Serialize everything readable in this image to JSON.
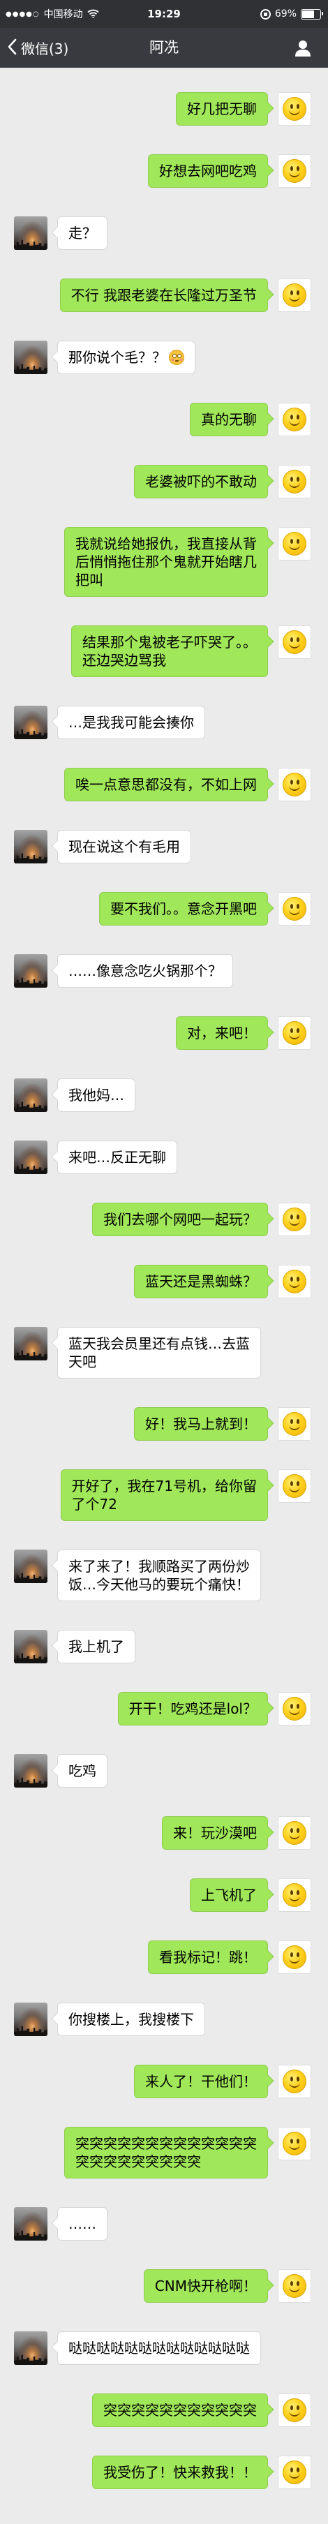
{
  "status_bar": {
    "signal": "●●●●○",
    "carrier": "中国移动",
    "time": "19:29",
    "battery_percent": "69%",
    "icons": [
      "wifi-icon",
      "rotation-lock-icon",
      "battery-icon"
    ]
  },
  "nav_bar": {
    "back_label": "微信(3)",
    "title": "阿冼",
    "icons": [
      "chevron-left-icon",
      "person-icon"
    ]
  },
  "colors": {
    "chat_background": "#ebebeb",
    "sent_bubble": "#a0e759",
    "received_bubble": "#ffffff",
    "nav_bar": "#393a3f"
  },
  "messages": [
    {
      "side": "right",
      "lines": [
        "好几把无聊"
      ]
    },
    {
      "side": "right",
      "lines": [
        "好想去网吧吃鸡"
      ]
    },
    {
      "side": "left",
      "lines": [
        "走？"
      ]
    },
    {
      "side": "right",
      "lines": [
        "不行 我跟老婆在长隆过万圣节"
      ]
    },
    {
      "side": "left",
      "lines": [
        "那你说个毛？？"
      ],
      "emoji": "flushed-face"
    },
    {
      "side": "right",
      "lines": [
        "真的无聊"
      ]
    },
    {
      "side": "right",
      "lines": [
        "老婆被吓的不敢动"
      ]
    },
    {
      "side": "right",
      "lines": [
        "我就说给她报仇，我直接从背",
        "后悄悄拖住那个鬼就开始瞎几",
        "把叫"
      ]
    },
    {
      "side": "right",
      "lines": [
        "结果那个鬼被老子吓哭了。。",
        "还边哭边骂我"
      ]
    },
    {
      "side": "left",
      "lines": [
        "…是我我可能会揍你"
      ]
    },
    {
      "side": "right",
      "lines": [
        "唉一点意思都没有，不如上网"
      ]
    },
    {
      "side": "left",
      "lines": [
        "现在说这个有毛用"
      ]
    },
    {
      "side": "right",
      "lines": [
        "要不我们。。意念开黑吧"
      ]
    },
    {
      "side": "left",
      "lines": [
        "……像意念吃火锅那个？"
      ]
    },
    {
      "side": "right",
      "lines": [
        "对，来吧！"
      ]
    },
    {
      "side": "left",
      "lines": [
        "我他妈…"
      ]
    },
    {
      "side": "left",
      "lines": [
        "来吧…反正无聊"
      ]
    },
    {
      "side": "right",
      "lines": [
        "我们去哪个网吧一起玩？"
      ]
    },
    {
      "side": "right",
      "lines": [
        "蓝天还是黑蜘蛛？"
      ]
    },
    {
      "side": "left",
      "lines": [
        "蓝天我会员里还有点钱…去蓝",
        "天吧"
      ]
    },
    {
      "side": "right",
      "lines": [
        "好！我马上就到！"
      ]
    },
    {
      "side": "right",
      "lines": [
        "开好了，我在71号机，给你留",
        "了个72"
      ]
    },
    {
      "side": "left",
      "lines": [
        "来了来了！我顺路买了两份炒",
        "饭…今天他马的要玩个痛快！"
      ]
    },
    {
      "side": "left",
      "lines": [
        "我上机了"
      ]
    },
    {
      "side": "right",
      "lines": [
        "开干！吃鸡还是lol？"
      ]
    },
    {
      "side": "left",
      "lines": [
        "吃鸡"
      ]
    },
    {
      "side": "right",
      "lines": [
        "来！玩沙漠吧"
      ]
    },
    {
      "side": "right",
      "lines": [
        "上飞机了"
      ]
    },
    {
      "side": "right",
      "lines": [
        "看我标记！跳！"
      ]
    },
    {
      "side": "left",
      "lines": [
        "你搜楼上，我搜楼下"
      ]
    },
    {
      "side": "right",
      "lines": [
        "来人了！干他们！"
      ]
    },
    {
      "side": "right",
      "lines": [
        "突突突突突突突突突突突突突",
        "突突突突突突突突突"
      ]
    },
    {
      "side": "left",
      "lines": [
        "……"
      ]
    },
    {
      "side": "right",
      "lines": [
        "CNM快开枪啊！"
      ]
    },
    {
      "side": "left",
      "lines": [
        "哒哒哒哒哒哒哒哒哒哒哒哒哒"
      ]
    },
    {
      "side": "right",
      "lines": [
        "突突突突突突突突突突突"
      ]
    },
    {
      "side": "right",
      "lines": [
        "我受伤了！快来救我！！"
      ]
    }
  ]
}
